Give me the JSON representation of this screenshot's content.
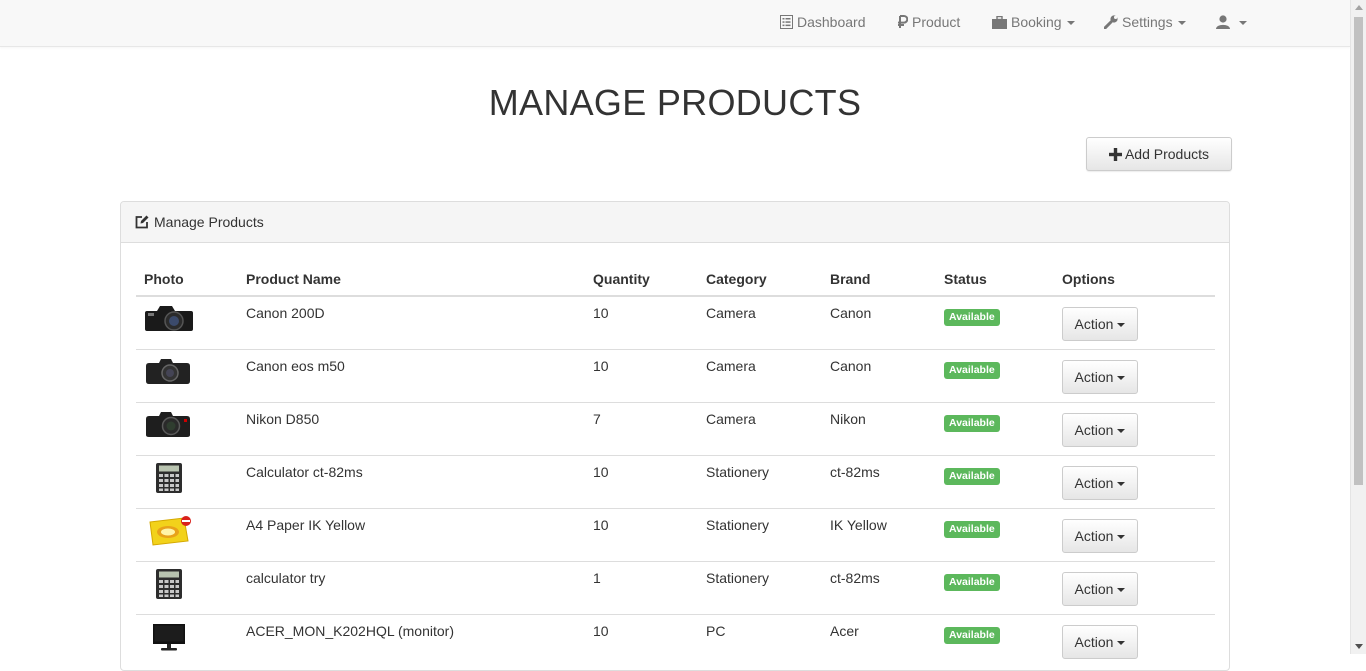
{
  "navbar": {
    "items": [
      {
        "label": "Dashboard",
        "icon": "list-alt-icon"
      },
      {
        "label": "Product",
        "icon": "ruble-icon"
      },
      {
        "label": "Booking",
        "icon": "briefcase-icon",
        "dropdown": true
      },
      {
        "label": "Settings",
        "icon": "wrench-icon",
        "dropdown": true
      },
      {
        "label": "",
        "icon": "user-icon",
        "dropdown": true
      }
    ]
  },
  "page": {
    "title": "MANAGE PRODUCTS",
    "add_button_label": "Add Products"
  },
  "panel": {
    "heading": "Manage Products"
  },
  "table": {
    "columns": [
      "Photo",
      "Product Name",
      "Quantity",
      "Category",
      "Brand",
      "Status",
      "Options"
    ],
    "rows": [
      {
        "photo": "camera-black-icon",
        "name": "Canon 200D",
        "quantity": "10",
        "category": "Camera",
        "brand": "Canon",
        "status": "Available",
        "action": "Action"
      },
      {
        "photo": "camera-black-icon",
        "name": "Canon eos m50",
        "quantity": "10",
        "category": "Camera",
        "brand": "Canon",
        "status": "Available",
        "action": "Action"
      },
      {
        "photo": "camera-black-icon",
        "name": "Nikon D850",
        "quantity": "7",
        "category": "Camera",
        "brand": "Nikon",
        "status": "Available",
        "action": "Action"
      },
      {
        "photo": "calculator-icon",
        "name": "Calculator ct-82ms",
        "quantity": "10",
        "category": "Stationery",
        "brand": "ct-82ms",
        "status": "Available",
        "action": "Action"
      },
      {
        "photo": "paper-ream-icon",
        "name": "A4 Paper IK Yellow",
        "quantity": "10",
        "category": "Stationery",
        "brand": "IK Yellow",
        "status": "Available",
        "action": "Action"
      },
      {
        "photo": "calculator-icon",
        "name": "calculator try",
        "quantity": "1",
        "category": "Stationery",
        "brand": "ct-82ms",
        "status": "Available",
        "action": "Action"
      },
      {
        "photo": "monitor-icon",
        "name": "ACER_MON_K202HQL (monitor)",
        "quantity": "10",
        "category": "PC",
        "brand": "Acer",
        "status": "Available",
        "action": "Action"
      }
    ]
  },
  "colors": {
    "navbar_bg": "#f8f8f8",
    "nav_text": "#777777",
    "badge_success": "#5cb85c",
    "panel_heading_bg": "#f5f5f5"
  }
}
